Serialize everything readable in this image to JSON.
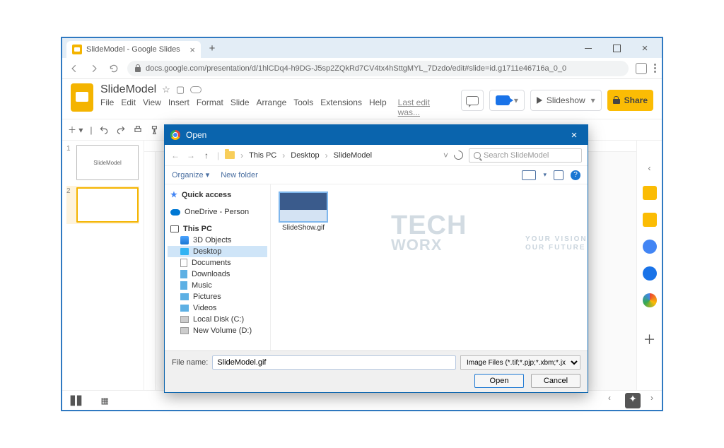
{
  "browser": {
    "tab_title": "SlideModel - Google Slides",
    "url": "docs.google.com/presentation/d/1hlCDq4-h9DG-J5sp2ZQkRd7CV4tx4hSttgMYL_7Dzdo/edit#slide=id.g1711e46716a_0_0"
  },
  "slides": {
    "doc_title": "SlideModel",
    "menu": [
      "File",
      "Edit",
      "View",
      "Insert",
      "Format",
      "Slide",
      "Arrange",
      "Tools",
      "Extensions",
      "Help"
    ],
    "last_edit": "Last edit was...",
    "slideshow_label": "Slideshow",
    "share_label": "Share",
    "thumbs": [
      {
        "num": "1",
        "label": "SlideModel"
      },
      {
        "num": "2",
        "label": ""
      }
    ]
  },
  "dialog": {
    "title": "Open",
    "breadcrumb": [
      "This PC",
      "Desktop",
      "SlideModel"
    ],
    "search_placeholder": "Search SlideModel",
    "organize": "Organize",
    "new_folder": "New folder",
    "tree": {
      "quick_access": "Quick access",
      "onedrive": "OneDrive - Person",
      "this_pc": "This PC",
      "children": [
        "3D Objects",
        "Desktop",
        "Documents",
        "Downloads",
        "Music",
        "Pictures",
        "Videos",
        "Local Disk (C:)",
        "New Volume (D:)"
      ]
    },
    "file": {
      "name": "SlideShow.gif"
    },
    "file_name_label": "File name:",
    "file_name_value": "SlideModel.gif",
    "file_type": "Image Files (*.tif;*.pjp;*.xbm;*.jx",
    "open_btn": "Open",
    "cancel_btn": "Cancel"
  },
  "watermark": {
    "line1": "TECH",
    "line2": "WORX",
    "tag1": "YOUR VISION",
    "tag2": "OUR FUTURE"
  }
}
